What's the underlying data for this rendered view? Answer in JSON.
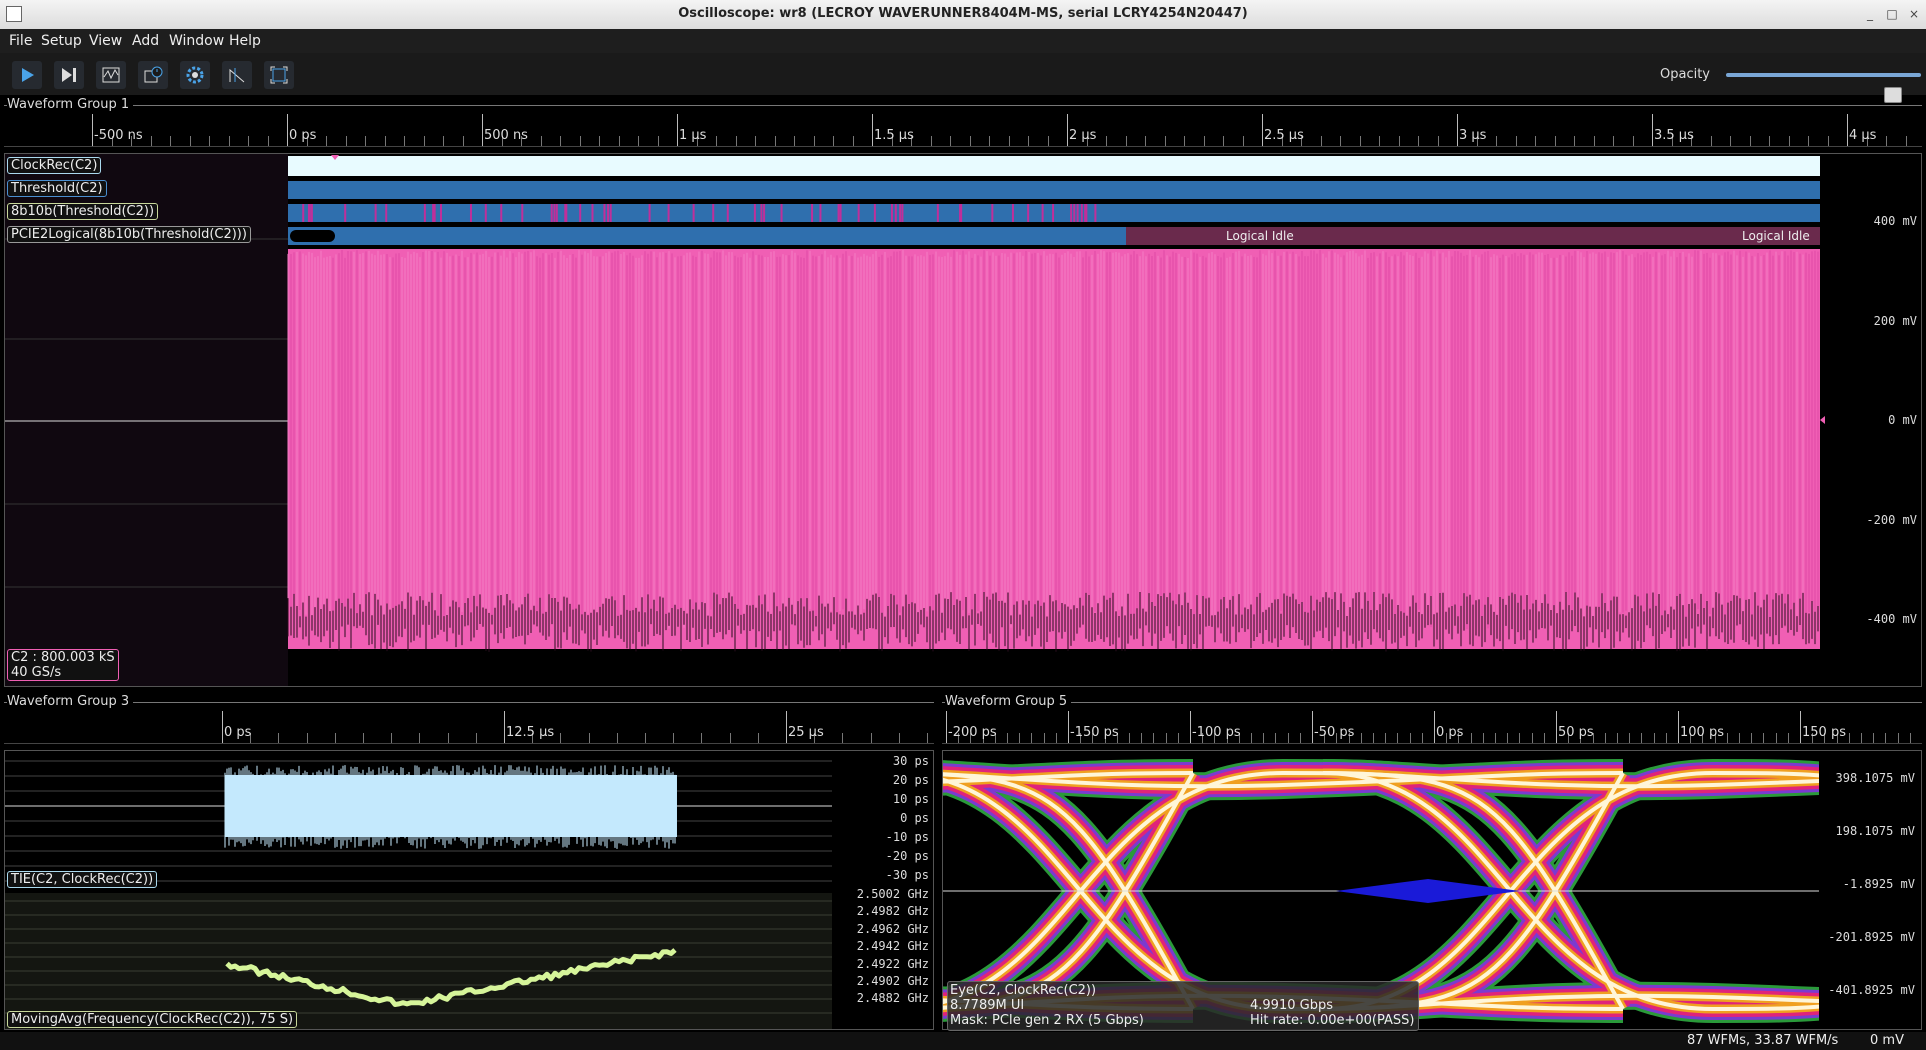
{
  "window": {
    "title": "Oscilloscope: wr8 (LECROY WAVERUNNER8404M-MS, serial LCRY4254N20447)"
  },
  "menu": [
    "File",
    "Setup",
    "View",
    "Add",
    "Window",
    "Help"
  ],
  "toolbar": {
    "buttons": [
      "play-icon",
      "step-icon",
      "waveform-icon",
      "history-icon",
      "settings-icon",
      "trigger-icon",
      "fullscreen-icon"
    ],
    "opacity_label": "Opacity",
    "opacity_value": 0.85
  },
  "group1": {
    "label": "Waveform Group 1",
    "ticks": [
      "-500 ns",
      "0 ps",
      "500 ns",
      "1 µs",
      "1.5 µs",
      "2 µs",
      "2.5 µs",
      "3 µs",
      "3.5 µs",
      "4 µs"
    ],
    "channels": [
      "ClockRec(C2)",
      "Threshold(C2)",
      "8b10b(Threshold(C2))",
      "PCIE2Logical(8b10b(Threshold(C2)))"
    ],
    "logical_idle": [
      "Logical Idle",
      "Logical Idle"
    ],
    "y_labels": [
      "400 mV",
      "200 mV",
      "0 mV",
      "-200 mV",
      "-400 mV"
    ],
    "info_line1": "C2 : 800.003 kS",
    "info_line2": "40 GS/s"
  },
  "group3": {
    "label": "Waveform Group 3",
    "ticks": [
      "0 ps",
      "12.5 µs",
      "25 µs"
    ],
    "tie_label": "TIE(C2, ClockRec(C2))",
    "tie_y": [
      "30 ps",
      "20 ps",
      "10 ps",
      "0 ps",
      "-10 ps",
      "-20 ps",
      "-30 ps"
    ],
    "freq_label": "MovingAvg(Frequency(ClockRec(C2)), 75 S)",
    "freq_y": [
      "2.5002 GHz",
      "2.4982 GHz",
      "2.4962 GHz",
      "2.4942 GHz",
      "2.4922 GHz",
      "2.4902 GHz",
      "2.4882 GHz"
    ]
  },
  "group5": {
    "label": "Waveform Group 5",
    "ticks": [
      "-200 ps",
      "-150 ps",
      "-100 ps",
      "-50 ps",
      "0 ps",
      "50 ps",
      "100 ps",
      "150 ps"
    ],
    "y_labels": [
      "398.1075 mV",
      "198.1075 mV",
      "-1.8925 mV",
      "-201.8925 mV",
      "-401.8925 mV"
    ],
    "eye_name": "Eye(C2, ClockRec(C2))",
    "eye_ui": "8.7789M UI",
    "eye_rate": "4.9910 Gbps",
    "mask": "Mask: PCIe gen 2 RX (5 Gbps)",
    "hit_rate": "Hit rate: 0.00e+00(PASS)"
  },
  "status": {
    "wfms": "87 WFMs, 33.87 WFM/s",
    "offset": "0 mV"
  },
  "colors": {
    "pink": "#f05fb4",
    "blue": "#2f6fae",
    "tie": "#c9ecff",
    "freq": "#d6f59a"
  }
}
